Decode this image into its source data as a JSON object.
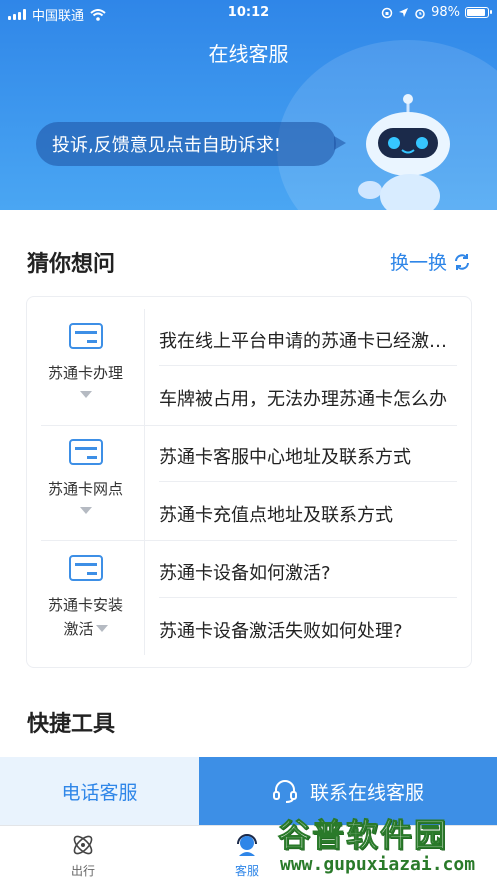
{
  "status_bar": {
    "carrier": "中国联通",
    "time": "10:12",
    "battery": "98%"
  },
  "header": {
    "title": "在线客服",
    "bubble_text": "投诉,反馈意见点击自助诉求!"
  },
  "guess": {
    "title": "猜你想问",
    "refresh_label": "换一换",
    "categories": [
      {
        "label": "苏通卡办理",
        "questions": [
          "我在线上平台申请的苏通卡已经激活了，为什么",
          "车牌被占用，无法办理苏通卡怎么办"
        ]
      },
      {
        "label": "苏通卡网点",
        "questions": [
          "苏通卡客服中心地址及联系方式",
          "苏通卡充值点地址及联系方式"
        ]
      },
      {
        "label_line1": "苏通卡安装",
        "label_line2": "激活",
        "questions": [
          "苏通卡设备如何激活?",
          "苏通卡设备激活失败如何处理?"
        ]
      }
    ]
  },
  "tools": {
    "title": "快捷工具"
  },
  "buttons": {
    "phone": "电话客服",
    "online": "联系在线客服"
  },
  "tabbar": {
    "items": [
      {
        "label": "出行"
      },
      {
        "label": "客服"
      }
    ]
  },
  "watermark": {
    "text": "谷普软件园",
    "url": "www.gupuxiazai.com"
  },
  "colors": {
    "accent": "#2f86e8",
    "button_light": "#e9f3fd",
    "button_dark": "#3d8fe6"
  }
}
